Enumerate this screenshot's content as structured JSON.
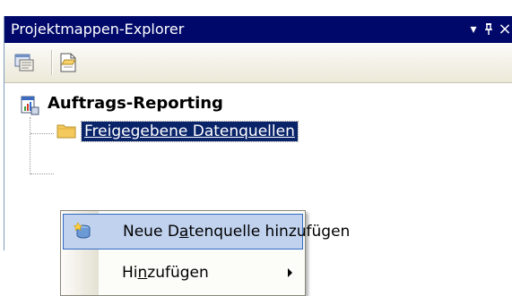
{
  "panel": {
    "title": "Projektmappen-Explorer",
    "controls": {
      "dropdown": "▾",
      "pin": "ᵽ",
      "close": "×"
    }
  },
  "toolbar": {
    "buttons": [
      {
        "icon": "properties-icon"
      },
      {
        "icon": "show-all-files-icon"
      }
    ]
  },
  "tree": {
    "root": {
      "label": "Auftrags-Reporting",
      "icon": "report-project-icon"
    },
    "children": [
      {
        "label": "Freigegebene Datenquellen",
        "icon": "folder-icon",
        "selected": true
      }
    ]
  },
  "context_menu": {
    "items": [
      {
        "label_parts": [
          "Neue D",
          "a",
          "tenquelle hinzufügen"
        ],
        "icon": "add-datasource-icon",
        "highlighted": true
      },
      {
        "label_parts": [
          "Hi",
          "n",
          "zufügen"
        ],
        "has_submenu": true
      }
    ]
  },
  "colors": {
    "titlebar": "#00086a",
    "selection": "#0a246a",
    "menu_highlight": "#c1d2ee",
    "menu_highlight_border": "#316ac5"
  }
}
